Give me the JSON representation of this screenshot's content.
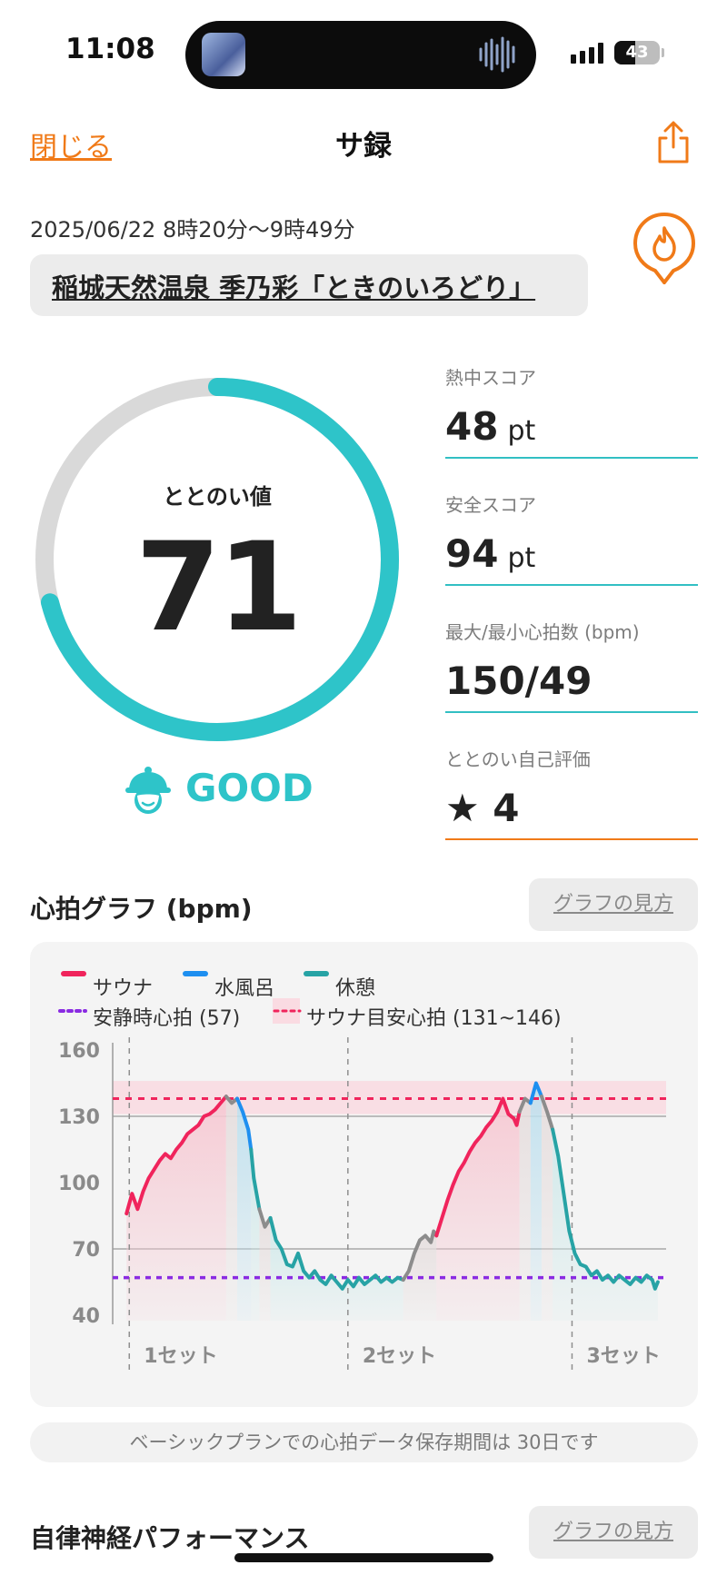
{
  "status_bar": {
    "time": "11:08",
    "battery": "43"
  },
  "nav": {
    "close_label": "閉じる",
    "title": "サ録"
  },
  "session": {
    "datetime": "2025/06/22 8時20分〜9時49分",
    "facility": "稲城天然温泉 季乃彩「ときのいろどり」"
  },
  "gauge": {
    "label": "ととのい値",
    "value": "71",
    "max": 100,
    "rating": "GOOD"
  },
  "stats": [
    {
      "label": "熱中スコア",
      "value": "48",
      "unit": "pt"
    },
    {
      "label": "安全スコア",
      "value": "94",
      "unit": "pt"
    },
    {
      "label": "最大/最小心拍数 (bpm)",
      "value": "150/49",
      "unit": ""
    },
    {
      "label": "ととのい自己評価",
      "value": "★ 4",
      "unit": ""
    }
  ],
  "heart_graph": {
    "title": "心拍グラフ (bpm)",
    "howto_label": "グラフの見方",
    "notice": "ベーシックプランでの心拍データ保存期間は 30日です"
  },
  "autonomic": {
    "title": "自律神経パフォーマンス",
    "howto_label": "グラフの見方"
  },
  "colors": {
    "accent": "#f07a18",
    "teal": "#2ec4c9",
    "sauna": "#f0245c",
    "water": "#1e8ff0",
    "rest": "#27a3a5",
    "resting": "#8a2be2"
  },
  "chart_data": {
    "type": "line",
    "legend": [
      "サウナ",
      "水風呂",
      "休憩",
      "安静時心拍 (57)",
      "サウナ目安心拍 (131~146)"
    ],
    "ylim": [
      40,
      160
    ],
    "yticks": [
      "160",
      "130",
      "100",
      "70",
      "40"
    ],
    "set_labels": [
      "1セット",
      "2セット",
      "3セット"
    ],
    "resting_hr": 57,
    "target_band": [
      131,
      146
    ],
    "target_line": 138,
    "x_range": [
      0,
      100
    ],
    "set_boundaries": [
      3,
      42.5,
      83
    ],
    "segments": [
      {
        "phase": "sauna",
        "points": [
          [
            2.5,
            86
          ],
          [
            3.5,
            95
          ],
          [
            4.5,
            88
          ],
          [
            5.5,
            96
          ],
          [
            6.5,
            102
          ],
          [
            7.5,
            106
          ],
          [
            8.5,
            110
          ],
          [
            9.5,
            113
          ],
          [
            10.5,
            111
          ],
          [
            11.5,
            115
          ],
          [
            12.5,
            118
          ],
          [
            13.5,
            122
          ],
          [
            14.5,
            124
          ],
          [
            15.5,
            126
          ],
          [
            16.5,
            130
          ],
          [
            17.5,
            131
          ],
          [
            18.5,
            133
          ],
          [
            19.5,
            136
          ],
          [
            20.5,
            139
          ]
        ]
      },
      {
        "phase": "gray",
        "points": [
          [
            20.5,
            139
          ],
          [
            21.5,
            136
          ],
          [
            22.5,
            138
          ]
        ]
      },
      {
        "phase": "water",
        "points": [
          [
            22.5,
            138
          ],
          [
            23.5,
            132
          ],
          [
            24.5,
            124
          ],
          [
            25,
            115
          ]
        ]
      },
      {
        "phase": "rest",
        "points": [
          [
            25,
            115
          ],
          [
            25.5,
            102
          ],
          [
            26,
            95
          ],
          [
            26.5,
            88
          ]
        ]
      },
      {
        "phase": "gray",
        "points": [
          [
            26.5,
            88
          ],
          [
            27.5,
            80
          ],
          [
            28.5,
            84
          ]
        ]
      },
      {
        "phase": "rest",
        "points": [
          [
            28.5,
            84
          ],
          [
            29.5,
            74
          ],
          [
            30.5,
            70
          ],
          [
            31.5,
            63
          ],
          [
            32.5,
            62
          ],
          [
            33.5,
            68
          ],
          [
            34.5,
            60
          ],
          [
            35.5,
            57
          ],
          [
            36.5,
            60
          ],
          [
            37.5,
            56
          ],
          [
            38.5,
            54
          ],
          [
            39.5,
            58
          ],
          [
            40.5,
            55
          ],
          [
            41.5,
            52
          ],
          [
            42.5,
            56
          ],
          [
            43.5,
            53
          ],
          [
            44.5,
            57
          ],
          [
            45.5,
            54
          ],
          [
            46.5,
            56
          ],
          [
            47.5,
            58
          ],
          [
            48.5,
            55
          ],
          [
            49.5,
            57
          ],
          [
            50.5,
            55
          ],
          [
            51.5,
            57
          ],
          [
            52.5,
            56
          ]
        ]
      },
      {
        "phase": "gray",
        "points": [
          [
            52.5,
            56
          ],
          [
            53.5,
            60
          ],
          [
            54.5,
            68
          ],
          [
            55.5,
            74
          ],
          [
            56.5,
            76
          ],
          [
            57.5,
            73
          ],
          [
            58,
            78
          ],
          [
            58.5,
            76
          ]
        ]
      },
      {
        "phase": "sauna",
        "points": [
          [
            58.5,
            76
          ],
          [
            59.5,
            84
          ],
          [
            60.5,
            92
          ],
          [
            61.5,
            99
          ],
          [
            62.5,
            105
          ],
          [
            63.5,
            109
          ],
          [
            64.5,
            114
          ],
          [
            65.5,
            118
          ],
          [
            66.5,
            121
          ],
          [
            67.5,
            125
          ],
          [
            68.5,
            128
          ],
          [
            69.5,
            132
          ],
          [
            70.5,
            138
          ],
          [
            71.5,
            131
          ],
          [
            72.5,
            129
          ],
          [
            73,
            126
          ],
          [
            73.5,
            132
          ]
        ]
      },
      {
        "phase": "gray",
        "points": [
          [
            73.5,
            132
          ],
          [
            74.5,
            138
          ],
          [
            75.5,
            136
          ]
        ]
      },
      {
        "phase": "water",
        "points": [
          [
            75.5,
            136
          ],
          [
            76.5,
            145
          ],
          [
            77.5,
            139
          ]
        ]
      },
      {
        "phase": "gray",
        "points": [
          [
            77.5,
            139
          ],
          [
            78.5,
            132
          ],
          [
            79.5,
            124
          ]
        ]
      },
      {
        "phase": "rest",
        "points": [
          [
            79.5,
            124
          ],
          [
            80.5,
            112
          ],
          [
            81.5,
            95
          ],
          [
            82.5,
            78
          ],
          [
            83.5,
            68
          ],
          [
            84.5,
            63
          ],
          [
            85.5,
            62
          ],
          [
            86.5,
            58
          ],
          [
            87.5,
            60
          ],
          [
            88.5,
            56
          ],
          [
            89.5,
            58
          ],
          [
            90.5,
            55
          ],
          [
            91.5,
            58
          ],
          [
            92.5,
            56
          ],
          [
            93.5,
            54
          ],
          [
            94.5,
            57
          ],
          [
            95.5,
            55
          ],
          [
            96.5,
            58
          ],
          [
            97.5,
            56
          ],
          [
            98,
            52
          ],
          [
            98.5,
            55
          ]
        ]
      }
    ]
  }
}
